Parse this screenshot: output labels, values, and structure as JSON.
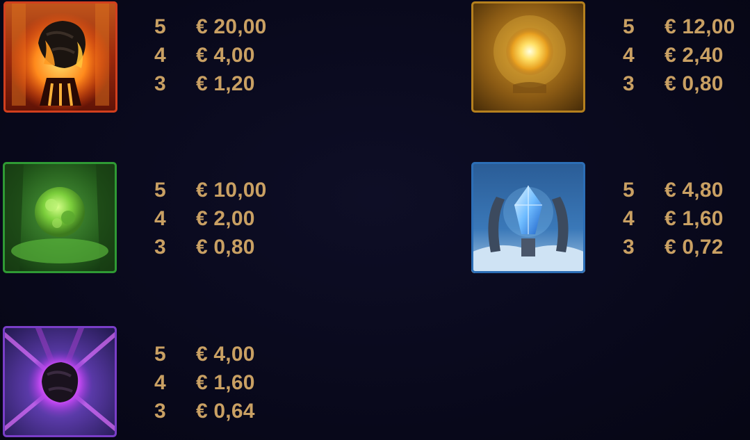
{
  "symbols": [
    {
      "name": "fire-symbol",
      "icon": "molten-rock-icon",
      "colors": {
        "frame": "#b8321a",
        "core": "#ffb13a"
      },
      "payouts": [
        {
          "count": "5",
          "amount": "€ 20,00"
        },
        {
          "count": "4",
          "amount": "€ 4,00"
        },
        {
          "count": "3",
          "amount": "€ 1,20"
        }
      ]
    },
    {
      "name": "gold-symbol",
      "icon": "golden-orb-icon",
      "colors": {
        "frame": "#a8761c",
        "core": "#fff08a"
      },
      "payouts": [
        {
          "count": "5",
          "amount": "€ 12,00"
        },
        {
          "count": "4",
          "amount": "€ 2,40"
        },
        {
          "count": "3",
          "amount": "€ 0,80"
        }
      ]
    },
    {
      "name": "green-symbol",
      "icon": "green-stone-icon",
      "colors": {
        "frame": "#2e8a2e",
        "core": "#a6ef60"
      },
      "payouts": [
        {
          "count": "5",
          "amount": "€ 10,00"
        },
        {
          "count": "4",
          "amount": "€ 2,00"
        },
        {
          "count": "3",
          "amount": "€ 0,80"
        }
      ]
    },
    {
      "name": "ice-symbol",
      "icon": "ice-crystal-icon",
      "colors": {
        "frame": "#2f6fb0",
        "core": "#9fd8ff"
      },
      "payouts": [
        {
          "count": "5",
          "amount": "€ 4,80"
        },
        {
          "count": "4",
          "amount": "€ 1,60"
        },
        {
          "count": "3",
          "amount": "€ 0,72"
        }
      ]
    },
    {
      "name": "purple-symbol",
      "icon": "dark-orb-icon",
      "colors": {
        "frame": "#6d36b8",
        "core": "#e06cff"
      },
      "payouts": [
        {
          "count": "5",
          "amount": "€ 4,00"
        },
        {
          "count": "4",
          "amount": "€ 1,60"
        },
        {
          "count": "3",
          "amount": "€ 0,64"
        }
      ]
    }
  ],
  "text_color": "#c9a063",
  "background_color": "#0a0a1c"
}
